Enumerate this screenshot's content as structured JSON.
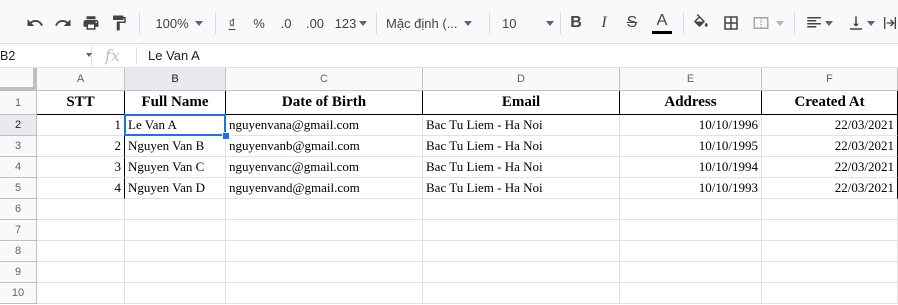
{
  "toolbar": {
    "zoom": "100%",
    "currency": "₫",
    "percent": "%",
    "dec_decrease": ".0",
    "dec_increase": ".00",
    "more_formats": "123",
    "font": "Mặc định (...",
    "font_size": "10",
    "bold": "B",
    "italic": "I",
    "strike": "S",
    "text_color": "A",
    "accent_color": "#1a73e8"
  },
  "formula_bar": {
    "cell_ref": "B2",
    "fx": "fx",
    "value": "Le Van A"
  },
  "columns": [
    "A",
    "B",
    "C",
    "D",
    "E",
    "F"
  ],
  "rows": [
    "1",
    "2",
    "3",
    "4",
    "5",
    "6",
    "7",
    "8",
    "9",
    "10"
  ],
  "header_row": [
    "STT",
    "Full Name",
    "Date of Birth",
    "Email",
    "Address",
    "Created At"
  ],
  "data_rows": [
    [
      "1",
      "Le Van A",
      "nguyenvana@gmail.com",
      "Bac Tu Liem - Ha Noi",
      "10/10/1996",
      "22/03/2021"
    ],
    [
      "2",
      "Nguyen Van B",
      "nguyenvanb@gmail.com",
      "Bac Tu Liem - Ha Noi",
      "10/10/1995",
      "22/03/2021"
    ],
    [
      "3",
      "Nguyen Van C",
      "nguyenvanc@gmail.com",
      "Bac Tu Liem - Ha Noi",
      "10/10/1994",
      "22/03/2021"
    ],
    [
      "4",
      "Nguyen Van D",
      "nguyenvand@gmail.com",
      "Bac Tu Liem - Ha Noi",
      "10/10/1993",
      "22/03/2021"
    ]
  ],
  "selected_cell": "B2"
}
